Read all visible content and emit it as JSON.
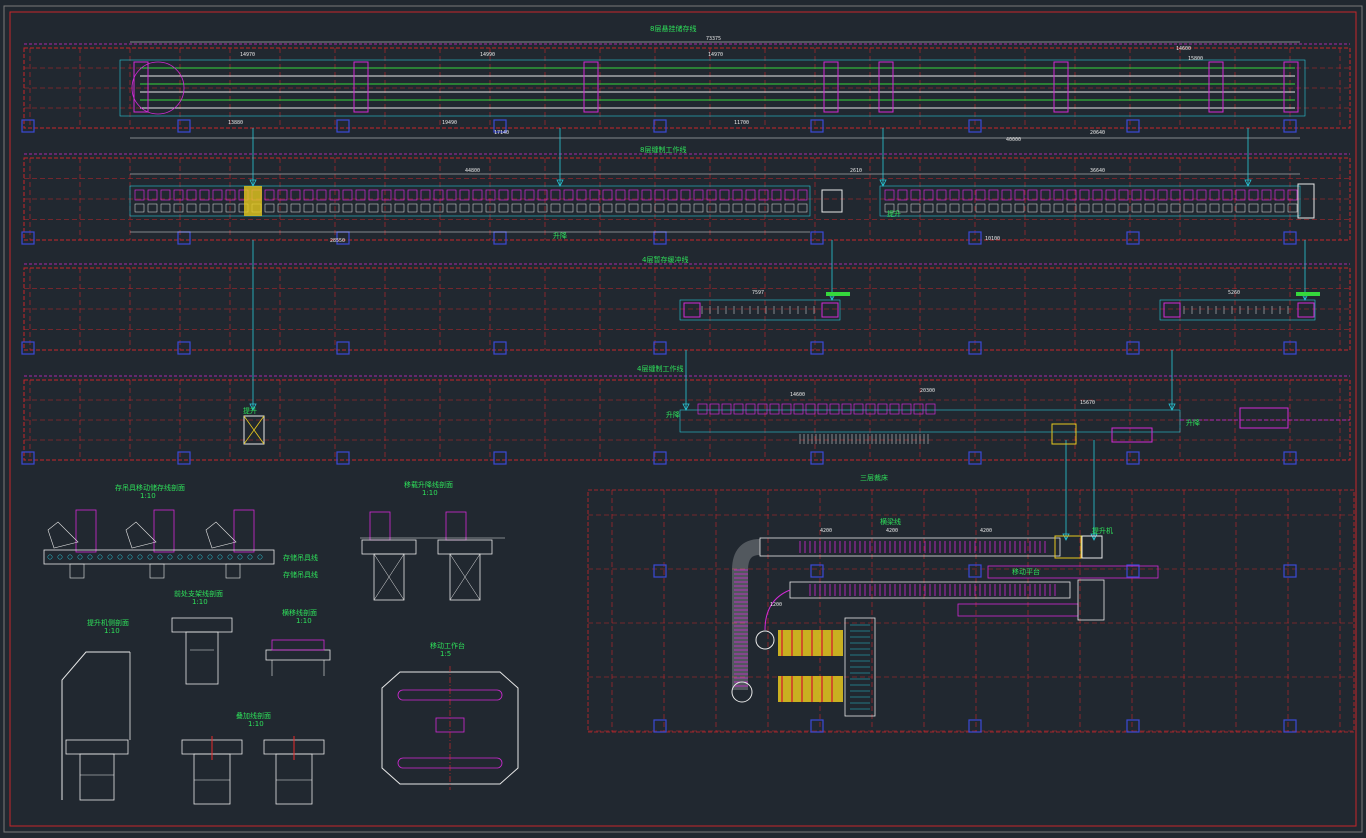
{
  "colors": {
    "background": "#212830",
    "grid_red": "#c8262a",
    "conveyor_green": "#35d83c",
    "magenta": "#d22ad6",
    "cyan": "#28c8d8",
    "white": "#e8e8e8",
    "column_blue": "#3b49d6",
    "yellow": "#e6c81e",
    "label_green": "#2ee05a"
  },
  "drawing": {
    "title_row1": "8层悬挂储存线",
    "title_row2": "8层缝制工作线",
    "title_row3": "4层暂存缓冲线",
    "title_row4": "4层缝制工作线",
    "title_floor": "三层裁床",
    "detail_a_title": "存吊具移动储存线剖面",
    "detail_a_scale": "1:10",
    "detail_b_title": "移载升降线剖面",
    "detail_b_scale": "1:10",
    "detail_c_title": "前处支架线剖面",
    "detail_c_scale": "1:10",
    "detail_d_title": "提升机侧剖面",
    "detail_d_scale": "1:10",
    "detail_e_title": "横移线剖面",
    "detail_e_scale": "1:10",
    "detail_f_title": "叠加线剖面",
    "detail_f_scale": "1:10",
    "detail_g_title": "移动工作台",
    "detail_g_scale": "1:5",
    "callout_a1": "存储吊具线",
    "callout_a2": "存储吊具线",
    "lift_label": "提升",
    "tag_l1": "升降",
    "tag_l2": "提升",
    "tag_l3": "升降",
    "tag_l4": "升降",
    "floor_tag1": "横梁线",
    "floor_tag2": "提升机",
    "floor_tag3": "移动平台",
    "dims_row1": [
      "73375",
      "14970",
      "14990",
      "14970",
      "14600",
      "15800",
      "13880",
      "19490",
      "17140",
      "11700",
      "20640",
      "40000"
    ],
    "dims_row2": [
      "44800",
      "2610",
      "36640",
      "10100",
      "28550"
    ],
    "dims_row3": [
      "7597",
      "5260"
    ],
    "dims_row4": [
      "14600",
      "20300",
      "15670"
    ],
    "dims_floor": [
      "4200",
      "4200",
      "4200",
      "1200"
    ]
  }
}
